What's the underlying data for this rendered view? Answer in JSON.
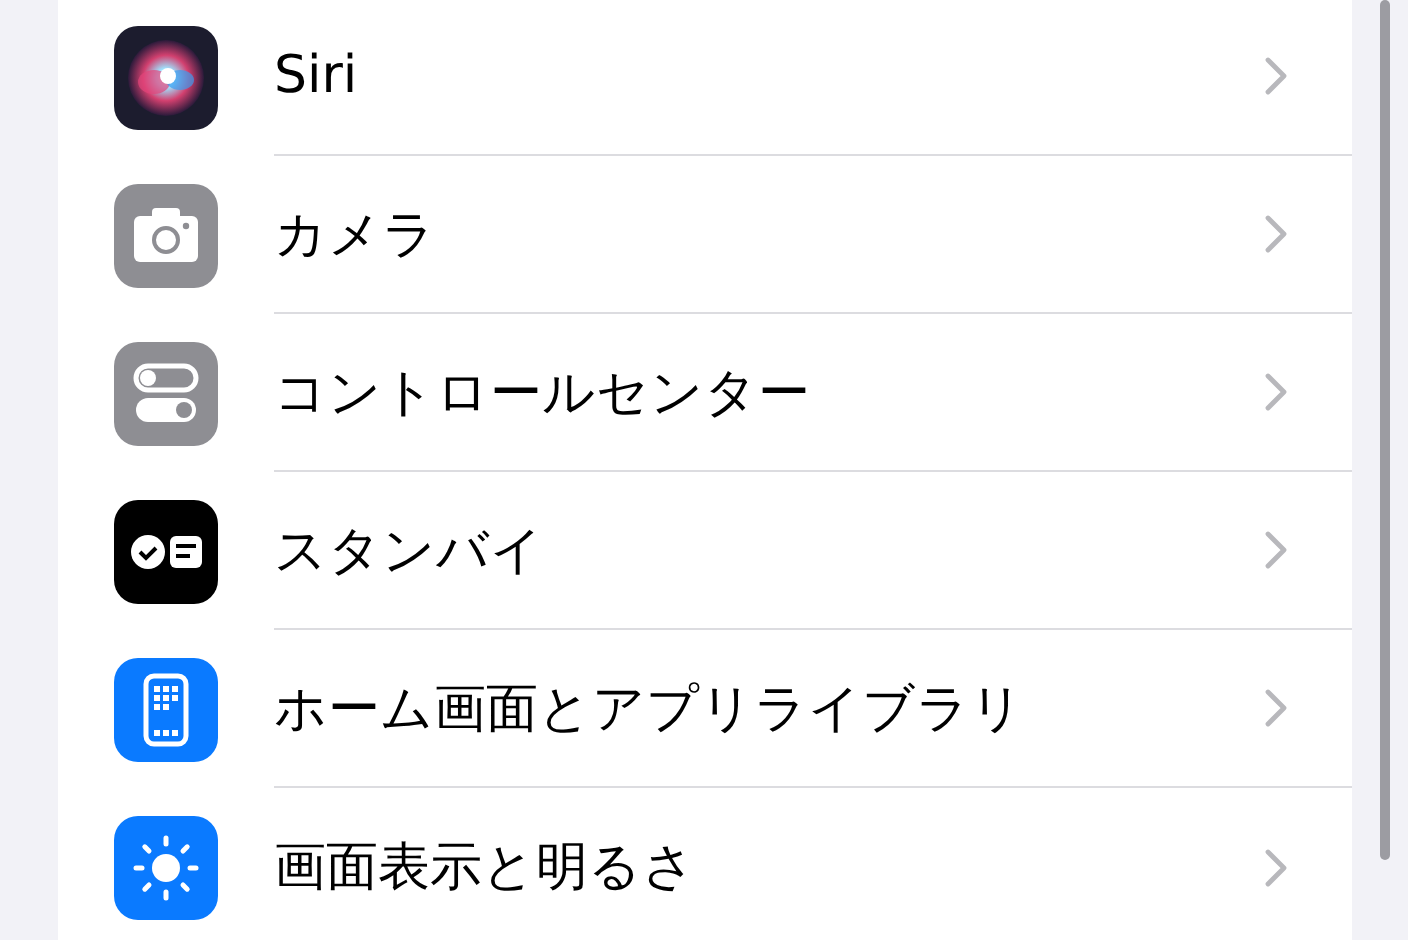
{
  "settings_list": [
    {
      "kind": "siri",
      "label": "Siri"
    },
    {
      "kind": "camera",
      "label": "カメラ"
    },
    {
      "kind": "control-center",
      "label": "コントロールセンター"
    },
    {
      "kind": "standby",
      "label": "スタンバイ"
    },
    {
      "kind": "home-screen",
      "label": "ホーム画面とアプリライブラリ"
    },
    {
      "kind": "display",
      "label": "画面表示と明るさ"
    }
  ]
}
